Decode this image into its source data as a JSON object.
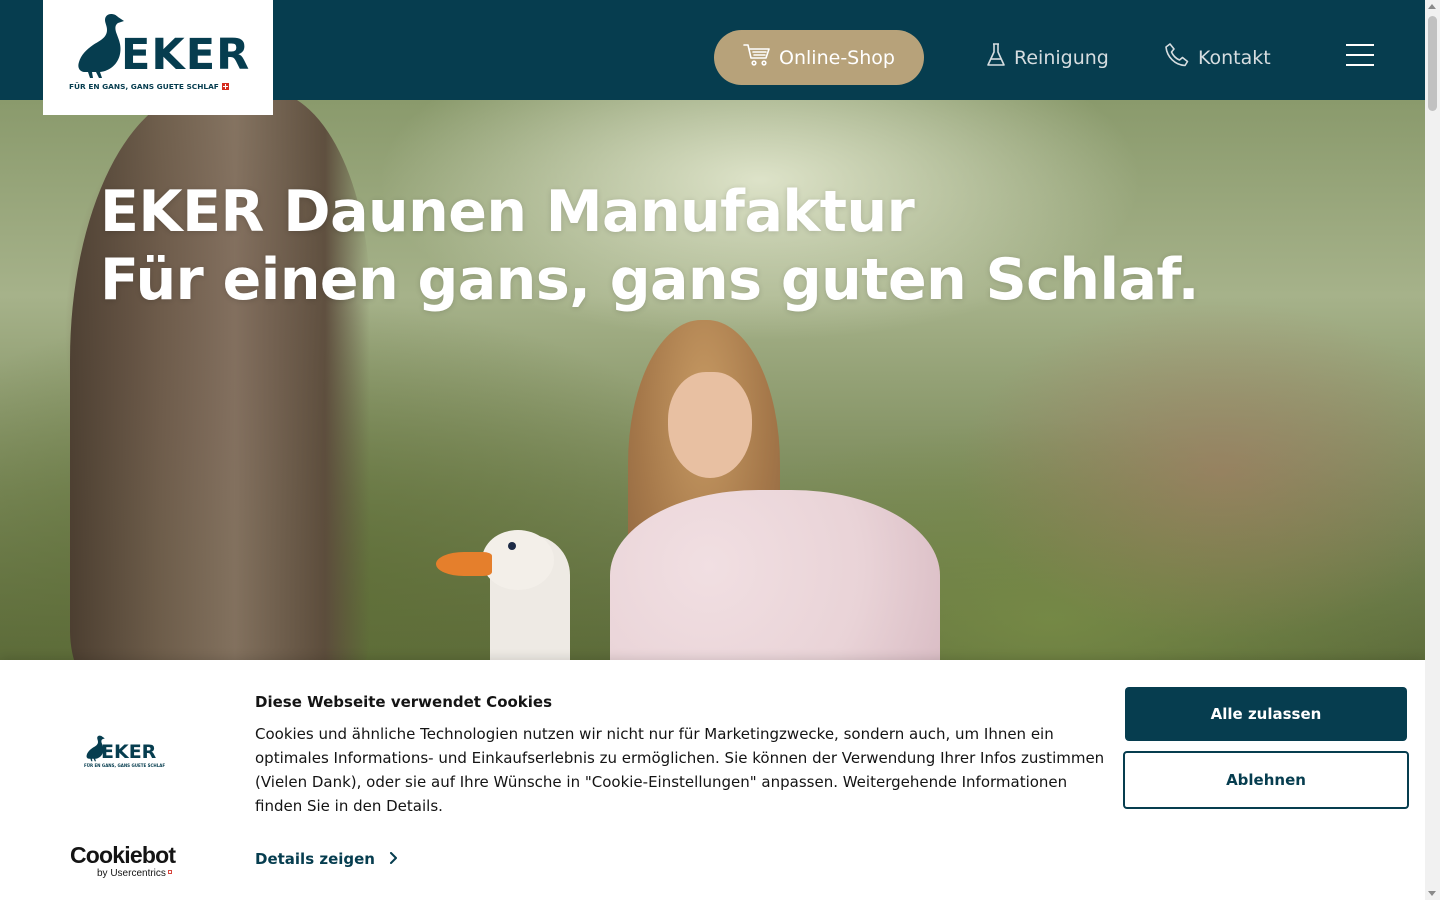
{
  "header": {
    "logo_text": "EKER",
    "logo_tagline": "FÜR EN GANS, GANS GUETE SCHLAF",
    "shop_label": "Online-Shop",
    "nav": [
      {
        "label": "Reinigung",
        "icon": "flask-icon"
      },
      {
        "label": "Kontakt",
        "icon": "phone-icon"
      }
    ],
    "menu_icon": "hamburger-menu-icon"
  },
  "hero": {
    "title_line1": "EKER Daunen Manufaktur",
    "title_line2": "Für einen gans, gans guten Schlaf."
  },
  "cookie_banner": {
    "brand_logo_text": "EKER",
    "brand_logo_tagline": "FÜR EN GANS, GANS GUETE SCHLAF",
    "provider_name": "Cookiebot",
    "provider_sub": "by Usercentrics",
    "title": "Diese Webseite verwendet Cookies",
    "text": "Cookies und ähnliche Technologien nutzen wir nicht nur für Marketingzwecke, sondern auch, um Ihnen ein optimales Informations- und Einkaufserlebnis zu ermöglichen. Sie können der Verwendung Ihrer Infos zustimmen (Vielen Dank), oder sie auf Ihre Wünsche in \"Cookie-Einstellungen\" anpassen. Weitergehende Informationen finden Sie in den Details.",
    "details_label": "Details zeigen",
    "allow_label": "Alle zulassen",
    "deny_label": "Ablehnen"
  },
  "colors": {
    "brand_dark": "#063d4f",
    "shop_button": "#b7a27a",
    "swiss_red": "#d52b1e"
  }
}
